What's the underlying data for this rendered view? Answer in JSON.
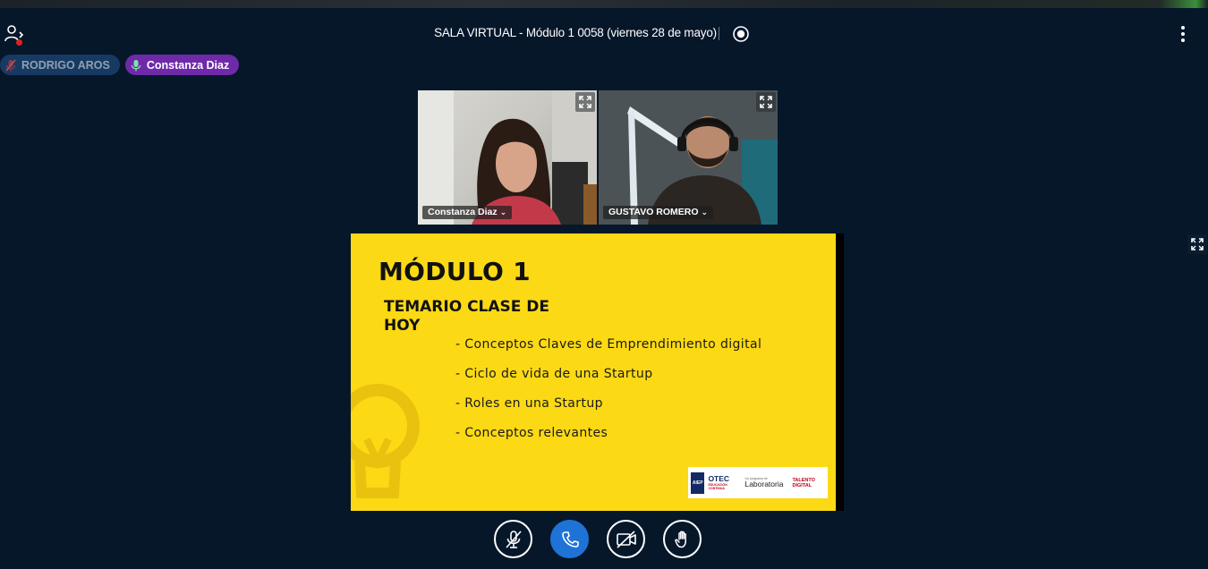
{
  "window": {
    "title": "SALA VIRTUAL - Módulo 1 0058 (viernes 28 de mayo)"
  },
  "header": {
    "users_toggle_icon": "users-list-icon",
    "record_icon": "record-icon",
    "more_icon": "more-options-vertical-icon"
  },
  "talkers": [
    {
      "name": "RODRIGO AROS",
      "state": "muted",
      "icon": "mic-muted-icon"
    },
    {
      "name": "Constanza Diaz",
      "state": "talking",
      "icon": "mic-icon"
    }
  ],
  "videos": [
    {
      "name": "Constanza Diaz"
    },
    {
      "name": "GUSTAVO ROMERO"
    }
  ],
  "slide": {
    "title": "MÓDULO 1",
    "subtitle": "TEMARIO CLASE DE HOY",
    "items": [
      "- Conceptos Claves de Emprendimiento digital",
      "- Ciclo de vida de una Startup",
      "- Roles en una Startup",
      "- Conceptos relevantes"
    ],
    "logos": {
      "aiep": "AIEP",
      "otec": "OTEC",
      "otec_sub": "EDUCACIÓN CONTINUA",
      "laboratoria": "Laboratoria",
      "laboratoria_sub": "Un programa de",
      "talento": "TALENTO DIGITAL"
    },
    "background_color": "#fbd914"
  },
  "controls": [
    {
      "name": "mute-mic-button",
      "icon": "mic-off-icon"
    },
    {
      "name": "leave-audio-button",
      "icon": "phone-icon"
    },
    {
      "name": "share-webcam-button",
      "icon": "camera-off-icon"
    },
    {
      "name": "raise-hand-button",
      "icon": "hand-icon"
    }
  ],
  "colors": {
    "background": "#06172a",
    "talker_active": "#6e2aa9",
    "talker_muted": "#173a63",
    "primary": "#1f73d6",
    "alert_dot": "#e02020"
  }
}
